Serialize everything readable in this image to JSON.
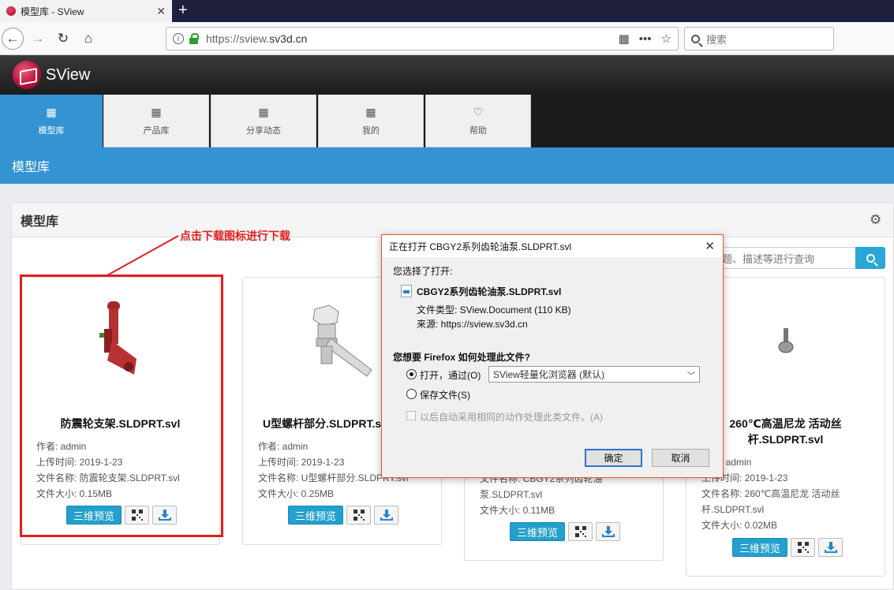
{
  "browser": {
    "tab_title": "模型库 - SView",
    "tab_close": "✕",
    "new_tab": "+",
    "url_host_prefix": "https://sview.",
    "url_host": "sv3d.cn",
    "search_placeholder": "搜索"
  },
  "site": {
    "brand": "SView",
    "nav": [
      {
        "label": "模型库",
        "icon": "grid-icon"
      },
      {
        "label": "产品库",
        "icon": "grid-icon"
      },
      {
        "label": "分享动态",
        "icon": "grid-icon"
      },
      {
        "label": "我的",
        "icon": "grid-icon"
      },
      {
        "label": "帮助",
        "icon": "heart-icon"
      }
    ],
    "section_title": "模型库",
    "panel_title": "模型库",
    "query_placeholder": "题、描述等进行查询"
  },
  "annotation": {
    "callout": "点击下载图标进行下载"
  },
  "cards": [
    {
      "title": "防震轮支架.SLDPRT.svl",
      "author": "作者: admin",
      "upload": "上传时间: 2019-1-23",
      "filename": "文件名称: 防震轮支架.SLDPRT.svl",
      "size": "文件大小: 0.15MB",
      "btn_3d": "三维预览"
    },
    {
      "title": "U型螺杆部分.SLDPRT.svl",
      "author": "作者: admin",
      "upload": "上传时间: 2019-1-23",
      "filename": "文件名称: U型螺杆部分.SLDPRT.svl",
      "size": "文件大小: 0.25MB",
      "btn_3d": "三维预览"
    },
    {
      "title": "",
      "filename_line1": "文件名称: CBGY2系列齿轮油",
      "filename_line2": "泵.SLDPRT.svl",
      "size": "文件大小: 0.11MB",
      "btn_3d": "三维预览"
    },
    {
      "title_line1": "260℃高温尼龙 活动丝",
      "title_line2": "杆.SLDPRT.svl",
      "author": "作者: admin",
      "upload": "上传时间: 2019-1-23",
      "filename_line1": "文件名称: 260℃高温尼龙 活动丝",
      "filename_line2": "杆.SLDPRT.svl",
      "size": "文件大小: 0.02MB",
      "btn_3d": "三维预览"
    }
  ],
  "dialog": {
    "title": "正在打开 CBGY2系列齿轮油泵.SLDPRT.svl",
    "close": "✕",
    "you_chose": "您选择了打开:",
    "filename": "CBGY2系列齿轮油泵.SLDPRT.svl",
    "filetype": "文件类型:   SView.Document (110 KB)",
    "source": "来源:    https://sview.sv3d.cn",
    "question": "您想要 Firefox 如何处理此文件?",
    "open_with": "打开，通过(O)",
    "app": "SView轻量化浏览器 (默认)",
    "save_file": "保存文件(S)",
    "auto": "以后自动采用相同的动作处理此类文件。(A)",
    "ok": "确定",
    "cancel": "取消",
    "selected_option": "open_with"
  },
  "colors": {
    "accent": "#3393d3",
    "annotation": "#e02020"
  }
}
